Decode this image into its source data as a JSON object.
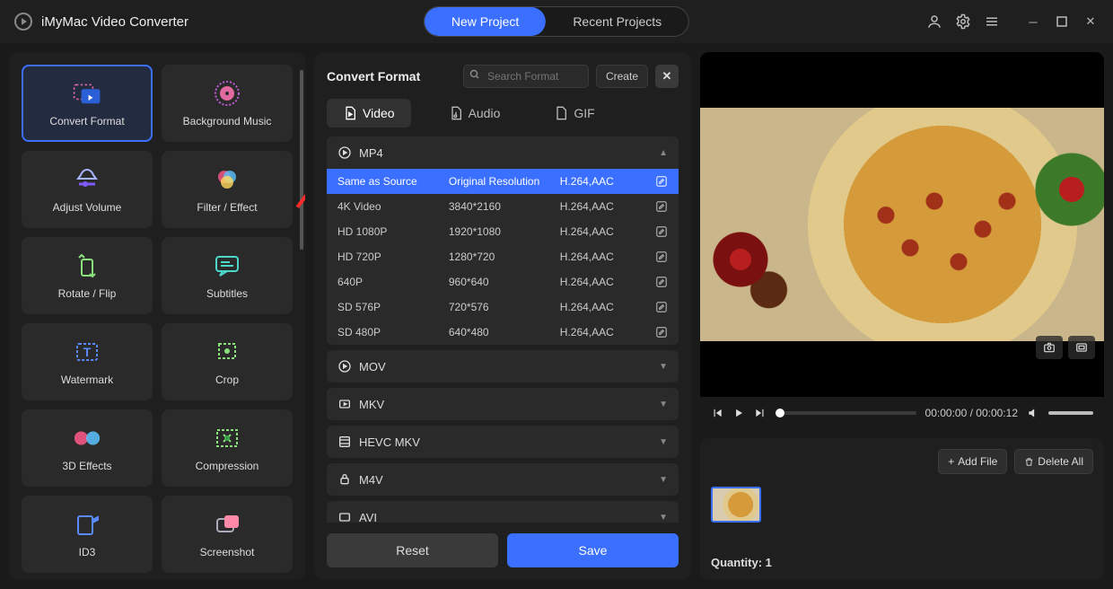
{
  "app": {
    "title": "iMyMac Video Converter"
  },
  "nav": {
    "new_project": "New Project",
    "recent_projects": "Recent Projects"
  },
  "sidebar": {
    "items": [
      {
        "label": "Convert Format",
        "selected": true
      },
      {
        "label": "Background Music"
      },
      {
        "label": "Adjust Volume"
      },
      {
        "label": "Filter / Effect"
      },
      {
        "label": "Rotate / Flip"
      },
      {
        "label": "Subtitles"
      },
      {
        "label": "Watermark"
      },
      {
        "label": "Crop"
      },
      {
        "label": "3D Effects"
      },
      {
        "label": "Compression"
      },
      {
        "label": "ID3"
      },
      {
        "label": "Screenshot"
      }
    ]
  },
  "center": {
    "title": "Convert Format",
    "search_placeholder": "Search Format",
    "create_label": "Create",
    "tabs": {
      "video": "Video",
      "audio": "Audio",
      "gif": "GIF"
    },
    "groups": [
      {
        "name": "MP4",
        "expanded": true,
        "rows": [
          {
            "name": "Same as Source",
            "res": "Original Resolution",
            "codec": "H.264,AAC",
            "selected": true
          },
          {
            "name": "4K Video",
            "res": "3840*2160",
            "codec": "H.264,AAC"
          },
          {
            "name": "HD 1080P",
            "res": "1920*1080",
            "codec": "H.264,AAC"
          },
          {
            "name": "HD 720P",
            "res": "1280*720",
            "codec": "H.264,AAC"
          },
          {
            "name": "640P",
            "res": "960*640",
            "codec": "H.264,AAC"
          },
          {
            "name": "SD 576P",
            "res": "720*576",
            "codec": "H.264,AAC"
          },
          {
            "name": "SD 480P",
            "res": "640*480",
            "codec": "H.264,AAC"
          }
        ]
      },
      {
        "name": "MOV"
      },
      {
        "name": "MKV"
      },
      {
        "name": "HEVC MKV"
      },
      {
        "name": "M4V"
      },
      {
        "name": "AVI"
      }
    ],
    "reset": "Reset",
    "save": "Save"
  },
  "preview": {
    "time_current": "00:00:00",
    "time_total": "00:00:12"
  },
  "queue": {
    "add_file": "Add File",
    "delete_all": "Delete All",
    "quantity_label": "Quantity: 1"
  }
}
